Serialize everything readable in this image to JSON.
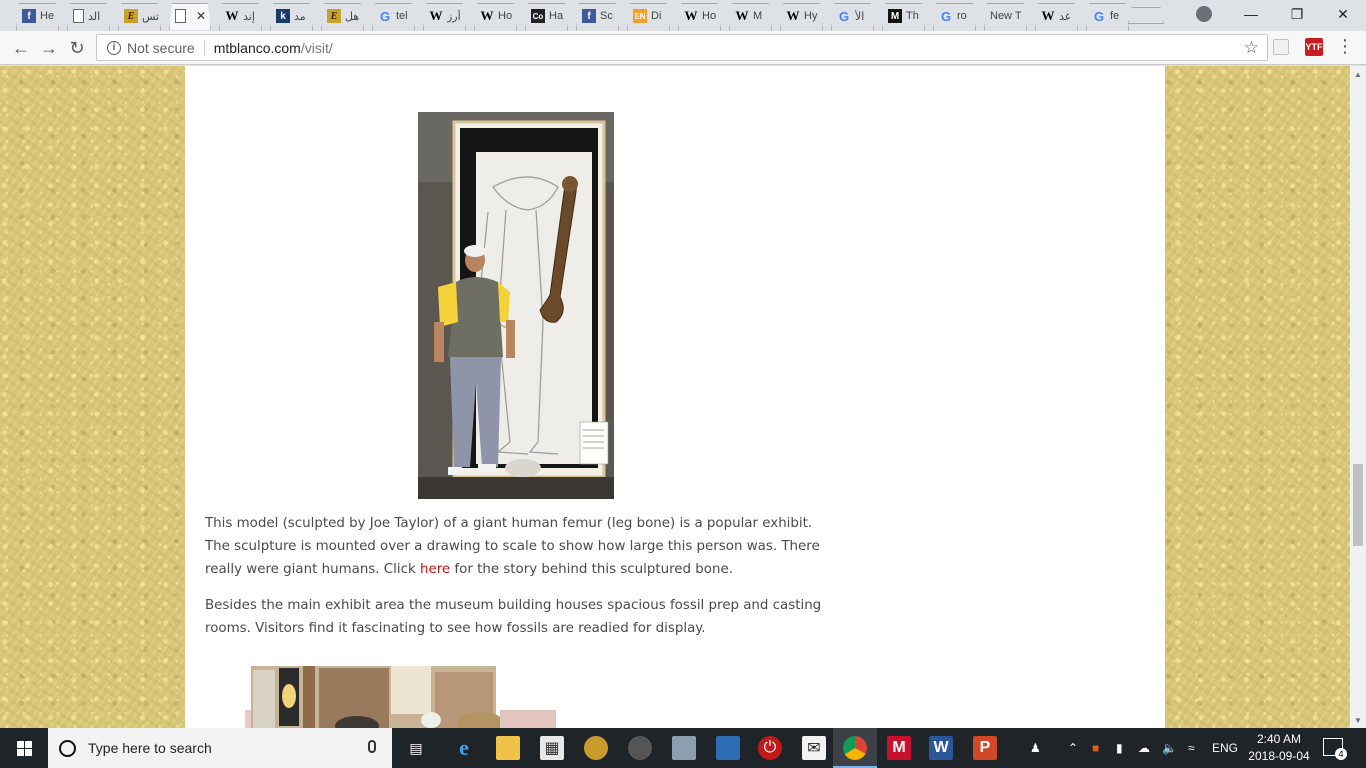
{
  "browser": {
    "tabs": [
      {
        "icon": "facebook-icon",
        "label": "He"
      },
      {
        "icon": "document-icon",
        "label": "الد"
      },
      {
        "icon": "e-icon",
        "label": "تس"
      },
      {
        "icon": "document-icon",
        "label": "",
        "active": true
      },
      {
        "icon": "wikipedia-icon",
        "label": "إند"
      },
      {
        "icon": "k-icon",
        "label": "مد"
      },
      {
        "icon": "e-icon",
        "label": "هل"
      },
      {
        "icon": "google-icon",
        "label": "tel"
      },
      {
        "icon": "wikipedia-icon",
        "label": "أرز"
      },
      {
        "icon": "wikipedia-icon",
        "label": "Ho"
      },
      {
        "icon": "co-icon",
        "label": "Ha"
      },
      {
        "icon": "facebook-icon",
        "label": "Sc"
      },
      {
        "icon": "en-icon",
        "label": "Di"
      },
      {
        "icon": "wikipedia-icon",
        "label": "Ho"
      },
      {
        "icon": "wikipedia-icon",
        "label": "M"
      },
      {
        "icon": "wikipedia-icon",
        "label": "Hy"
      },
      {
        "icon": "google-icon",
        "label": "الأ"
      },
      {
        "icon": "m-icon",
        "label": "Th"
      },
      {
        "icon": "google-icon",
        "label": "ro"
      },
      {
        "icon": "none",
        "label": "New T"
      },
      {
        "icon": "wikipedia-icon",
        "label": "غد"
      },
      {
        "icon": "google-icon",
        "label": "fe"
      }
    ],
    "address": {
      "security_label": "Not secure",
      "host": "mtblanco.com",
      "path": "/visit/"
    },
    "extension_label": "YTF"
  },
  "page": {
    "para1": {
      "before_link": "This model (sculpted by Joe Taylor) of a giant human femur (leg bone) is a popular exhibit. The sculpture is mounted over a drawing to scale to show how large this person was. There really were giant humans. Click ",
      "link": "here",
      "after_link": " for the story behind this sculptured bone."
    },
    "para2": "Besides the main exhibit area the museum building houses spacious fossil prep and casting rooms. Visitors find it fascinating to see how fossils are readied for display."
  },
  "taskbar": {
    "search_placeholder": "Type here to search",
    "language": "ENG",
    "time": "2:40 AM",
    "date": "2018-09-04",
    "notification_count": "4"
  },
  "colors": {
    "link": "#c0171b",
    "page_background": "#d8c676"
  }
}
